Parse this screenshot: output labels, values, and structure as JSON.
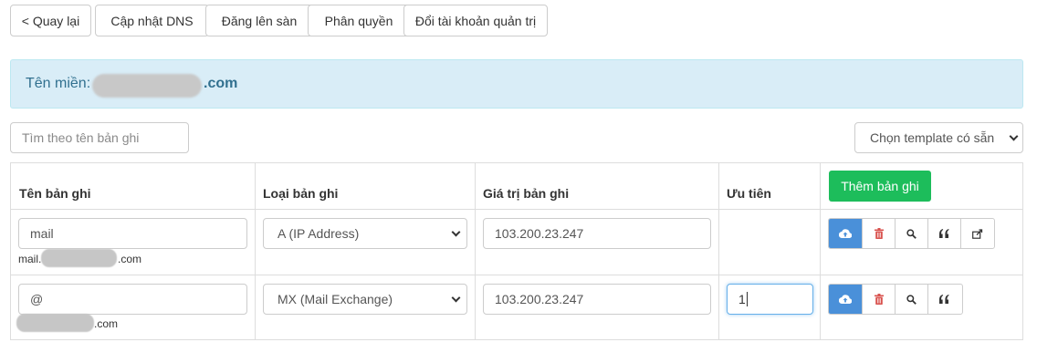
{
  "toolbar": {
    "back": "< Quay lại",
    "update_dns": "Cập nhật DNS",
    "post_market": "Đăng lên sàn",
    "permissions": "Phân quyền",
    "change_admin": "Đổi tài khoản quản trị"
  },
  "domain": {
    "label": "Tên miền:",
    "tld": ".com"
  },
  "search": {
    "placeholder": "Tìm theo tên bản ghi"
  },
  "template_select": {
    "value": "Chọn template có sẵn"
  },
  "table": {
    "headers": {
      "name": "Tên bản ghi",
      "type": "Loại bản ghi",
      "value": "Giá trị bản ghi",
      "priority": "Ưu tiên"
    },
    "add_button": "Thêm bản ghi",
    "rows": [
      {
        "name": "mail",
        "sub_prefix": "mail.",
        "sub_suffix": ".com",
        "type": "A (IP Address)",
        "value": "103.200.23.247",
        "priority": ""
      },
      {
        "name": "@",
        "sub_prefix": "",
        "sub_suffix": ".com",
        "type": "MX (Mail Exchange)",
        "value": "103.200.23.247",
        "priority": "1"
      }
    ]
  },
  "colors": {
    "primary": "#4a90d9",
    "success": "#1dbd5b",
    "danger": "#d9534f",
    "alert_bg": "#d9edf7",
    "alert_text": "#31708f"
  },
  "icons": [
    "cloud-upload-icon",
    "trash-icon",
    "search-icon",
    "quote-icon",
    "share-icon",
    "chevron-down-icon"
  ]
}
